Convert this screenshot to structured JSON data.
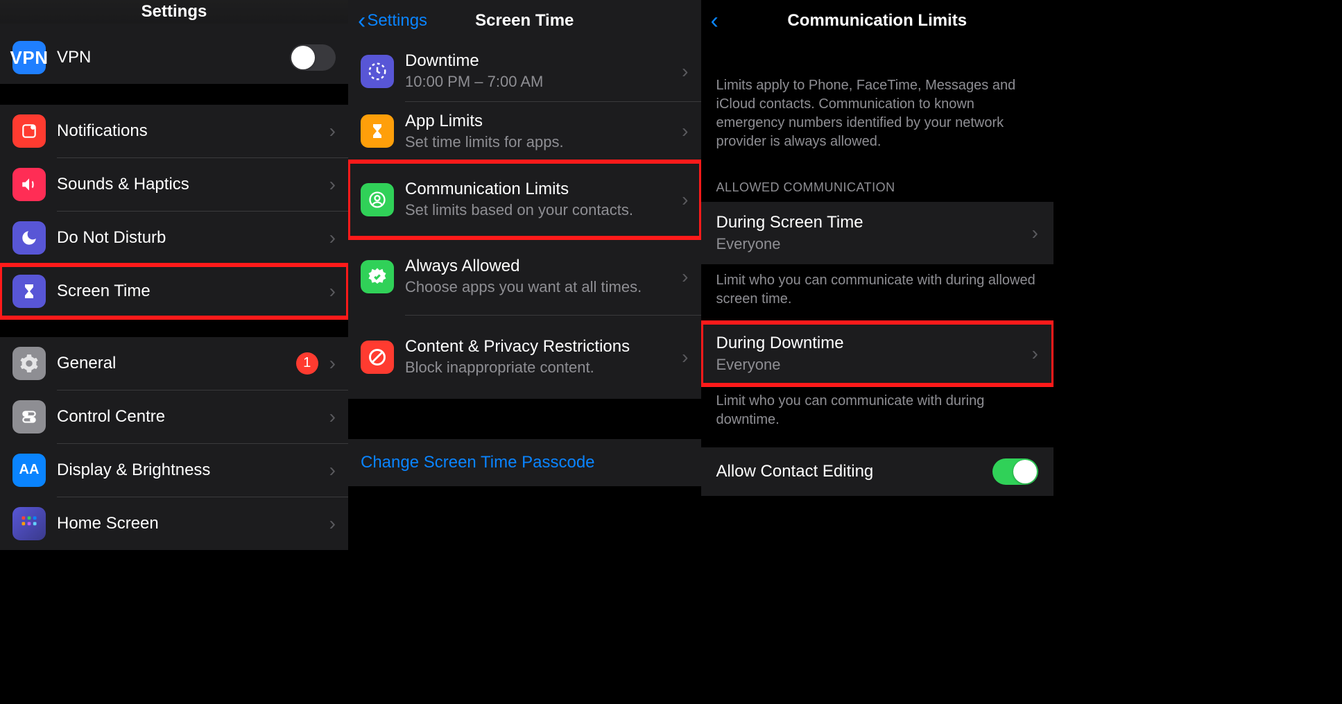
{
  "panel1": {
    "title": "Settings",
    "rows": {
      "vpn": "VPN",
      "notifications": "Notifications",
      "sounds": "Sounds & Haptics",
      "dnd": "Do Not Disturb",
      "screen_time": "Screen Time",
      "general": "General",
      "general_badge": "1",
      "control_centre": "Control Centre",
      "display": "Display & Brightness",
      "home_screen": "Home Screen"
    }
  },
  "panel2": {
    "back": "Settings",
    "title": "Screen Time",
    "downtime": {
      "title": "Downtime",
      "sub": "10:00 PM – 7:00 AM"
    },
    "app_limits": {
      "title": "App Limits",
      "sub": "Set time limits for apps."
    },
    "comm": {
      "title": "Communication Limits",
      "sub": "Set limits based on your contacts."
    },
    "always": {
      "title": "Always Allowed",
      "sub": "Choose apps you want at all times."
    },
    "restrict": {
      "title": "Content & Privacy Restrictions",
      "sub": "Block inappropriate content."
    },
    "change_passcode": "Change Screen Time Passcode"
  },
  "panel3": {
    "title": "Communication Limits",
    "intro": "Limits apply to Phone, FaceTime, Messages and iCloud contacts. Communication to known emergency numbers identified by your network provider is always allowed.",
    "section_header": "ALLOWED COMMUNICATION",
    "screen_time": {
      "title": "During Screen Time",
      "sub": "Everyone"
    },
    "screen_time_footer": "Limit who you can communicate with during allowed screen time.",
    "downtime": {
      "title": "During Downtime",
      "sub": "Everyone"
    },
    "downtime_footer": "Limit who you can communicate with during downtime.",
    "allow_contact": "Allow Contact Editing"
  }
}
